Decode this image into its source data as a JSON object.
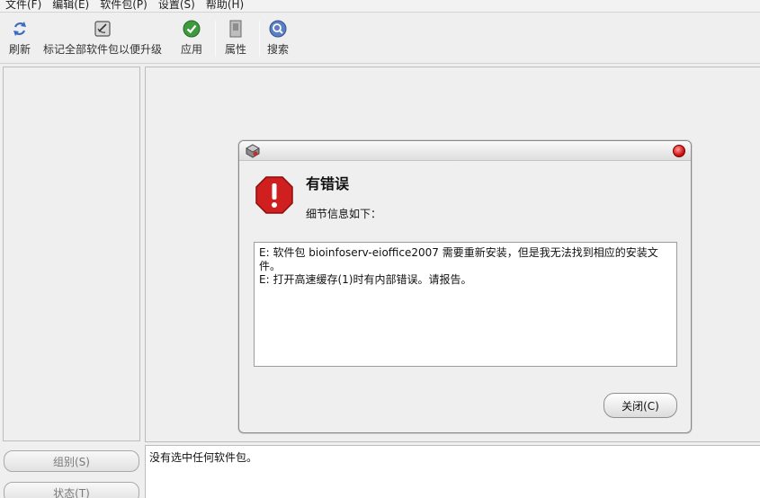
{
  "menubar": {
    "items": [
      "文件(F)",
      "编辑(E)",
      "软件包(P)",
      "设置(S)",
      "帮助(H)"
    ]
  },
  "toolbar": {
    "refresh": "刷新",
    "mark_all": "标记全部软件包以便升级",
    "apply": "应用",
    "properties": "属性",
    "search": "搜索"
  },
  "left": {
    "group_button": "组别(S)",
    "status_button": "状态(T)"
  },
  "status": {
    "text": "没有选中任何软件包。"
  },
  "dialog": {
    "heading": "有错误",
    "subheading": "细节信息如下：",
    "details": [
      "E: 软件包 bioinfoserv-eioffice2007 需要重新安装，但是我无法找到相应的安装文件。",
      "E: 打开高速缓存(1)时有内部错误。请报告。"
    ],
    "close_button": "关闭(C)"
  },
  "colors": {
    "error_red": "#d01f1f",
    "apply_green": "#2f8f2f",
    "search_blue": "#4a6fb5"
  }
}
